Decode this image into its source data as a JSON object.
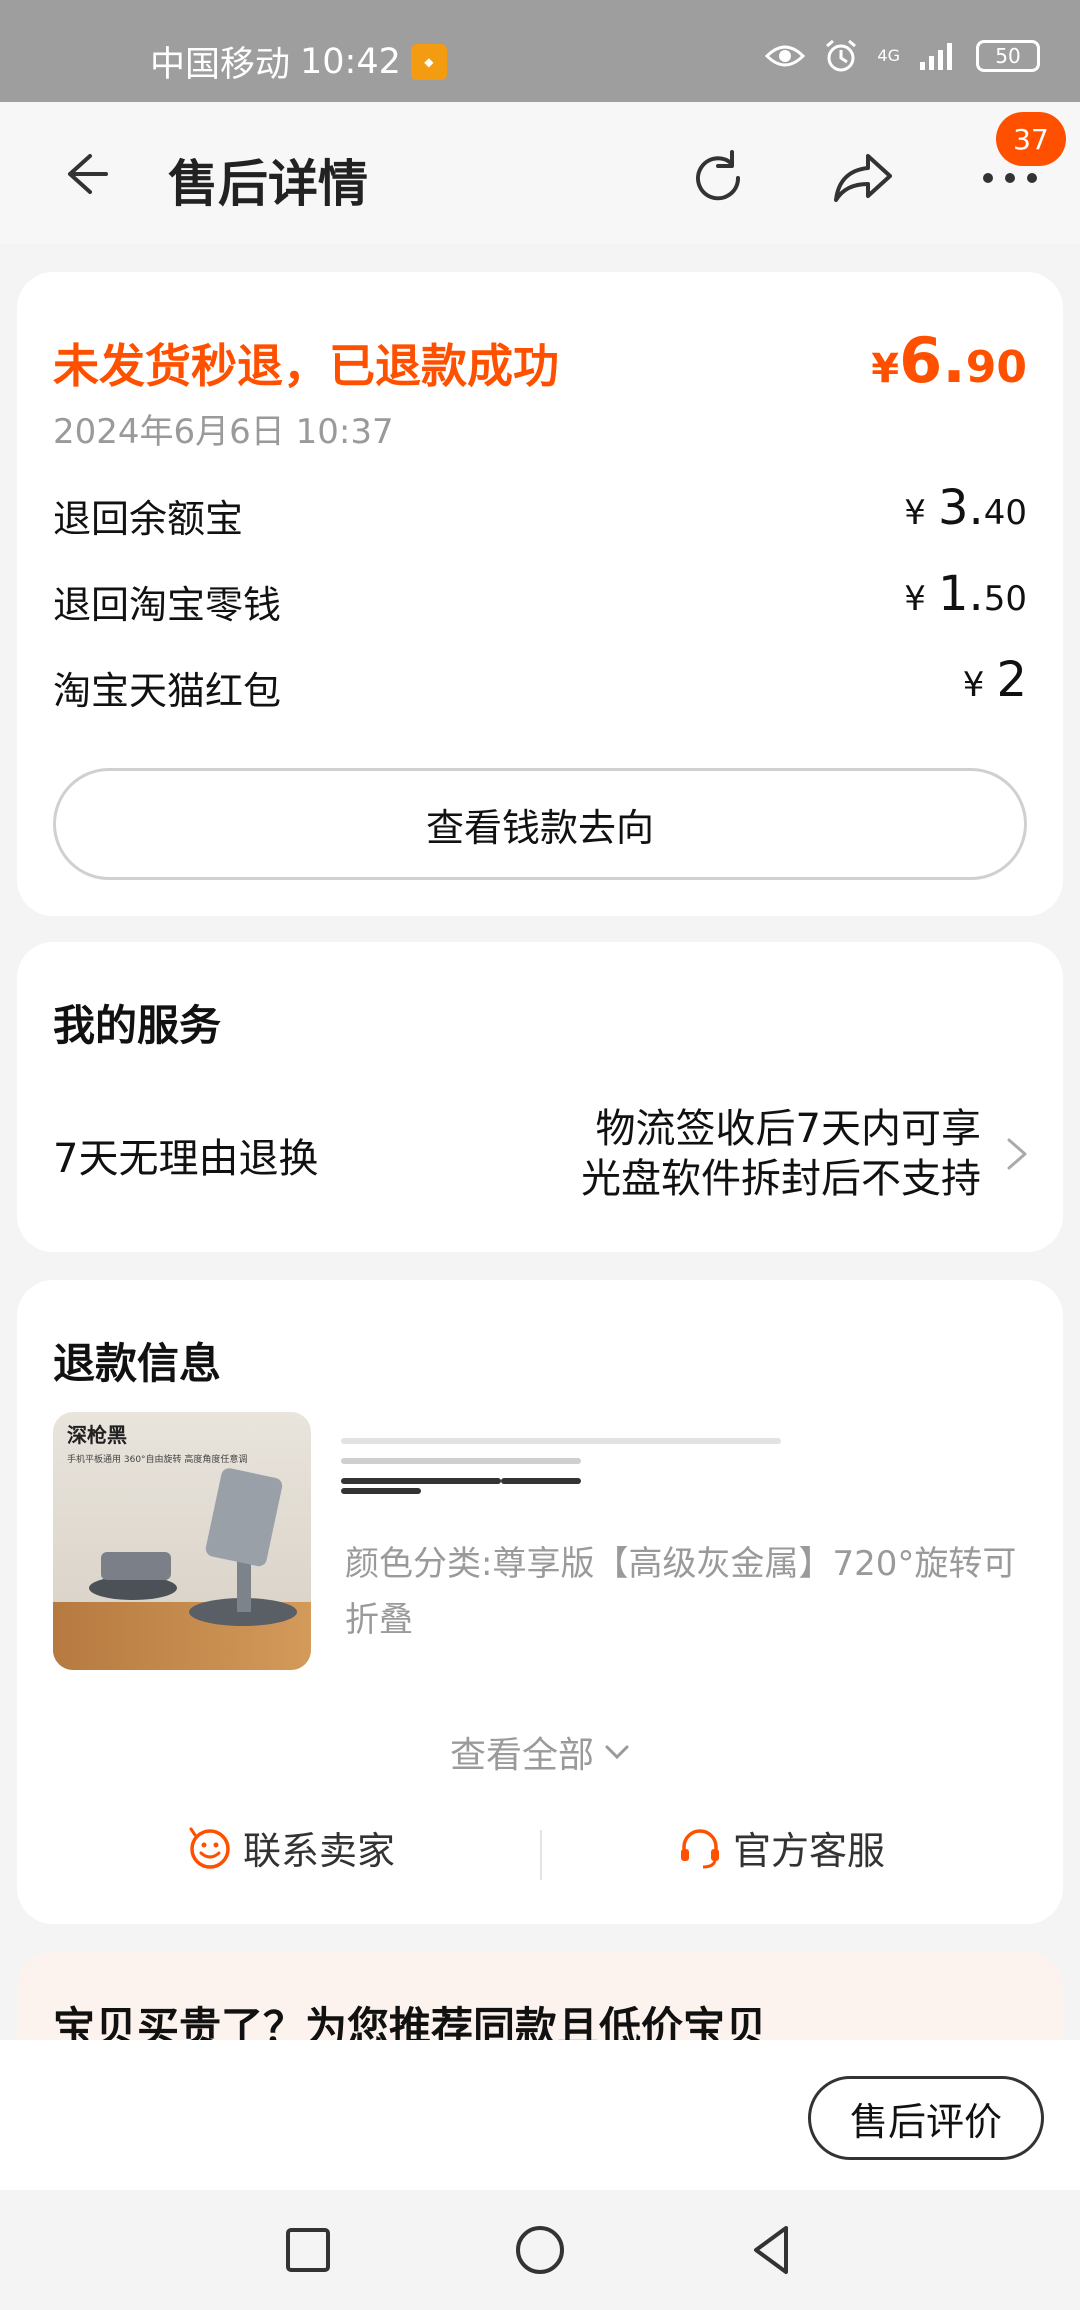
{
  "status_bar": {
    "carrier": "中国移动",
    "time": "10:42",
    "network": "4G",
    "battery": "50"
  },
  "header": {
    "title": "售后详情",
    "badge_count": "37"
  },
  "refund_summary": {
    "status": "未发货秒退，已退款成功",
    "currency": "¥",
    "total_int": "6.",
    "total_dec": "90",
    "date": "2024年6月6日 10:37",
    "lines": [
      {
        "label": "退回余额宝",
        "currency": "¥",
        "int": "3.",
        "dec": "40"
      },
      {
        "label": "退回淘宝零钱",
        "currency": "¥",
        "int": "1.",
        "dec": "50"
      },
      {
        "label": "淘宝天猫红包",
        "currency": "¥",
        "int": "2",
        "dec": ""
      }
    ],
    "track_button": "查看钱款去向"
  },
  "service": {
    "title": "我的服务",
    "name": "7天无理由退换",
    "desc_line1": "物流签收后7天内可享",
    "desc_line2": "光盘软件拆封后不支持"
  },
  "refund_info": {
    "title": "退款信息",
    "product_image_text": "深枪黑",
    "product_image_subtext": "手机平板通用 360°自由旋转 高度角度任意调",
    "spec": "颜色分类:尊享版【高级灰金属】720°旋转可折叠",
    "see_all": "查看全部",
    "contact_seller": "联系卖家",
    "official_service": "官方客服"
  },
  "recommend": {
    "title": "宝贝买贵了？为您推荐同款且低价宝贝"
  },
  "bottom_bar": {
    "review_button": "售后评价"
  },
  "colors": {
    "accent": "#ff5000",
    "muted": "#9a9a9a"
  },
  "icons": {
    "back": "back-arrow-icon",
    "refresh": "refresh-icon",
    "share": "share-icon",
    "more": "more-icon",
    "seller": "smile-chat-icon",
    "service": "headset-icon"
  }
}
